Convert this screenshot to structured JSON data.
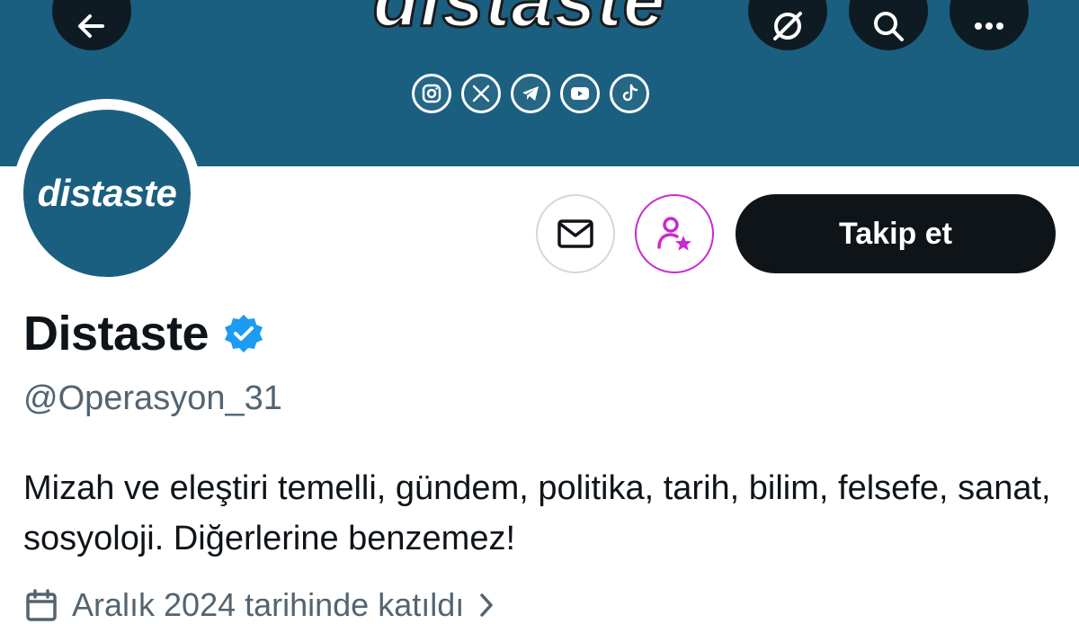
{
  "banner": {
    "title": "distaste",
    "background_color": "#1b5f80",
    "social_icons": [
      "instagram-icon",
      "x-icon",
      "telegram-icon",
      "youtube-icon",
      "tiktok-icon"
    ]
  },
  "nav": {
    "icons": [
      "back-arrow-icon",
      "grok-icon",
      "search-icon",
      "more-icon"
    ]
  },
  "avatar": {
    "text": "distaste"
  },
  "actions": {
    "message_icon": "mail-icon",
    "subscribe_icon": "person-star-icon",
    "subscribe_color": "#c92ad1",
    "follow_label": "Takip et"
  },
  "profile": {
    "name": "Distaste",
    "verified_color": "#1d9bf0",
    "handle": "@Operasyon_31",
    "bio": "Mizah ve eleştiri temelli, gündem, politika, tarih, bilim, felsefe, sanat, sosyoloji. Diğerlerine benzemez!",
    "joined": "Aralık 2024 tarihinde katıldı"
  }
}
